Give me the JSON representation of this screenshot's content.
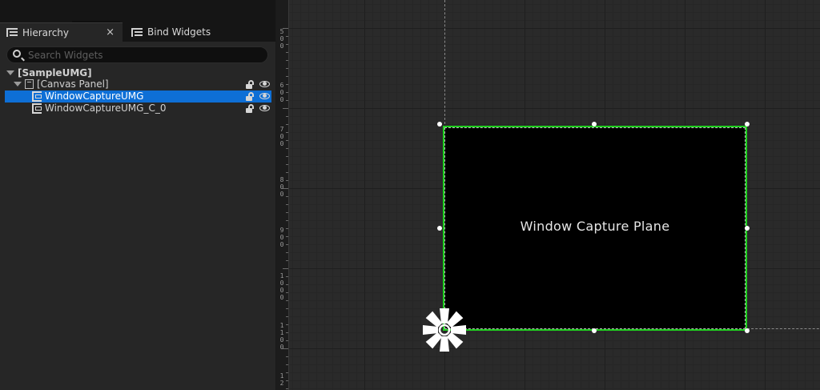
{
  "tabs": {
    "hierarchy": {
      "label": "Hierarchy",
      "close_glyph": "×"
    },
    "bind_widgets": {
      "label": "Bind Widgets"
    }
  },
  "search": {
    "placeholder": "Search Widgets",
    "value": ""
  },
  "tree": {
    "root": {
      "label": "[SampleUMG]"
    },
    "canvas_panel": {
      "label": "[Canvas Panel]"
    },
    "items": [
      {
        "label": "WindowCaptureUMG",
        "selected": true
      },
      {
        "label": "WindowCaptureUMG_C_0",
        "selected": false
      }
    ]
  },
  "viewport": {
    "ruler_labels": [
      "5\n0\n0",
      "6\n0\n0",
      "7\n0\n0",
      "8\n0\n0",
      "9\n0\n0",
      "1\n0\n0\n0",
      "1\n1\n0\n0",
      "1\n2"
    ],
    "capture_plane": {
      "text": "Window Capture Plane"
    }
  },
  "colors": {
    "selection": "#0e6fd6",
    "plane_border": "#1fd01f",
    "plane_fill": "#000000"
  },
  "icons": {
    "tab_hierarchy": "hierarchy-icon",
    "tab_bind": "bind-widgets-icon",
    "search": "search-icon",
    "lock": "lock-icon",
    "visibility": "eye-icon",
    "anchor": "anchor-icon"
  }
}
